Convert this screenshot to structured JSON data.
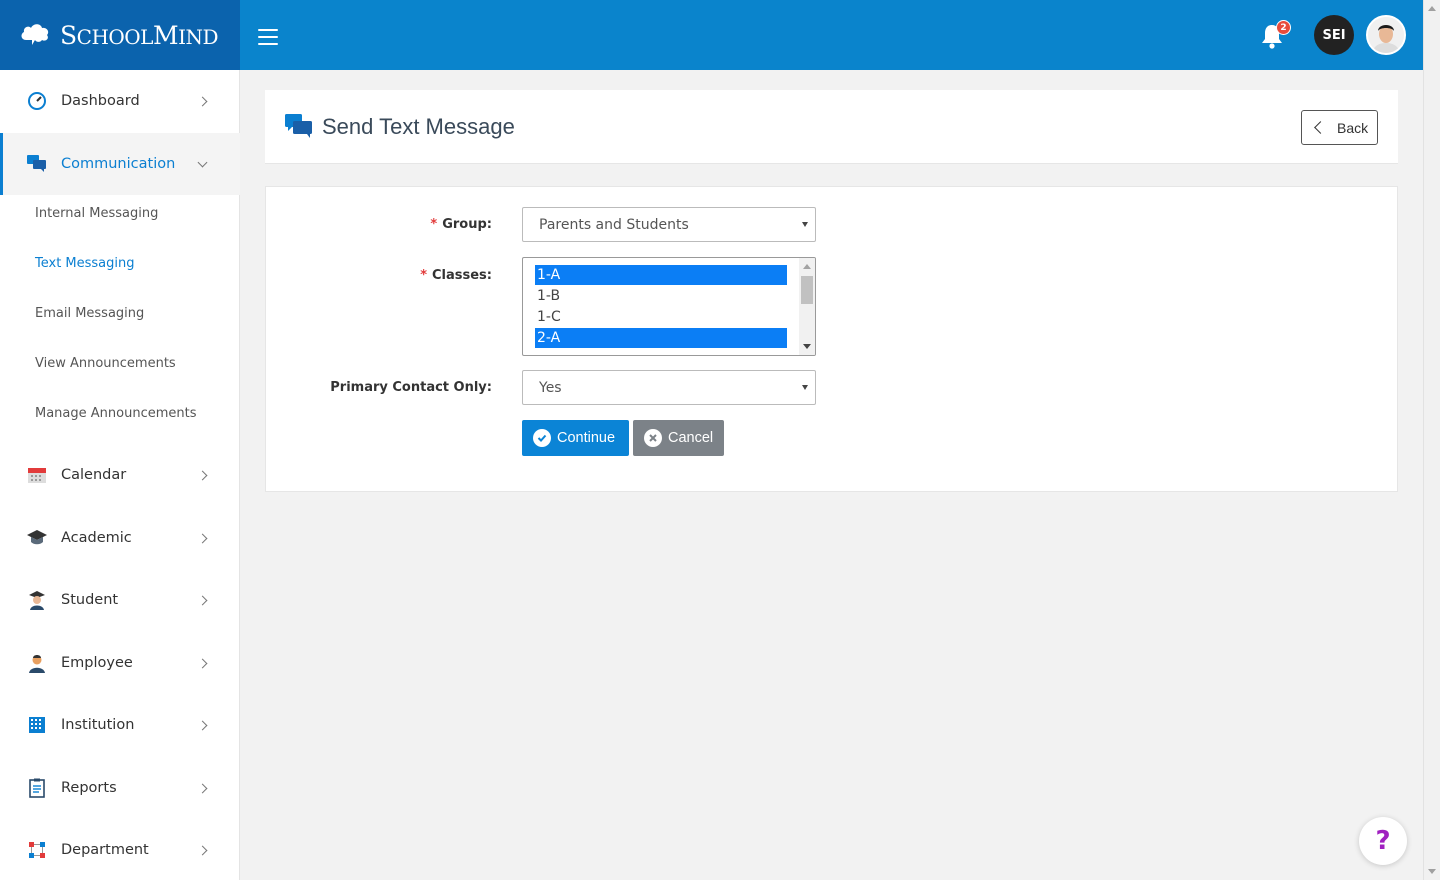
{
  "brand": {
    "name_big_s": "S",
    "name_rest1": "CHOOL",
    "name_big_m": "M",
    "name_rest2": "IND"
  },
  "header": {
    "notification_count": "2",
    "user_initials": "SEI"
  },
  "sidebar": {
    "items": [
      {
        "label": "Dashboard"
      },
      {
        "label": "Communication"
      },
      {
        "label": "Calendar"
      },
      {
        "label": "Academic"
      },
      {
        "label": "Student"
      },
      {
        "label": "Employee"
      },
      {
        "label": "Institution"
      },
      {
        "label": "Reports"
      },
      {
        "label": "Department"
      }
    ],
    "communication_sub": [
      {
        "label": "Internal Messaging"
      },
      {
        "label": "Text Messaging"
      },
      {
        "label": "Email Messaging"
      },
      {
        "label": "View Announcements"
      },
      {
        "label": "Manage Announcements"
      }
    ]
  },
  "page": {
    "title": "Send Text Message",
    "back_label": "Back"
  },
  "form": {
    "group_label": "Group:",
    "group_value": "Parents and Students",
    "classes_label": "Classes:",
    "classes_options": [
      "1-A",
      "1-B",
      "1-C",
      "2-A"
    ],
    "primary_contact_label": "Primary Contact Only:",
    "primary_contact_value": "Yes",
    "required_mark": "*",
    "continue_label": "Continue",
    "cancel_label": "Cancel"
  },
  "help": {
    "label": "?"
  },
  "colors": {
    "topbar": "#0a84cc",
    "brand_bg": "#0b63ad",
    "accent": "#0b7fd1",
    "selected_option": "#0b7ef5",
    "cancel": "#7c8288",
    "required": "#e23b3b"
  }
}
